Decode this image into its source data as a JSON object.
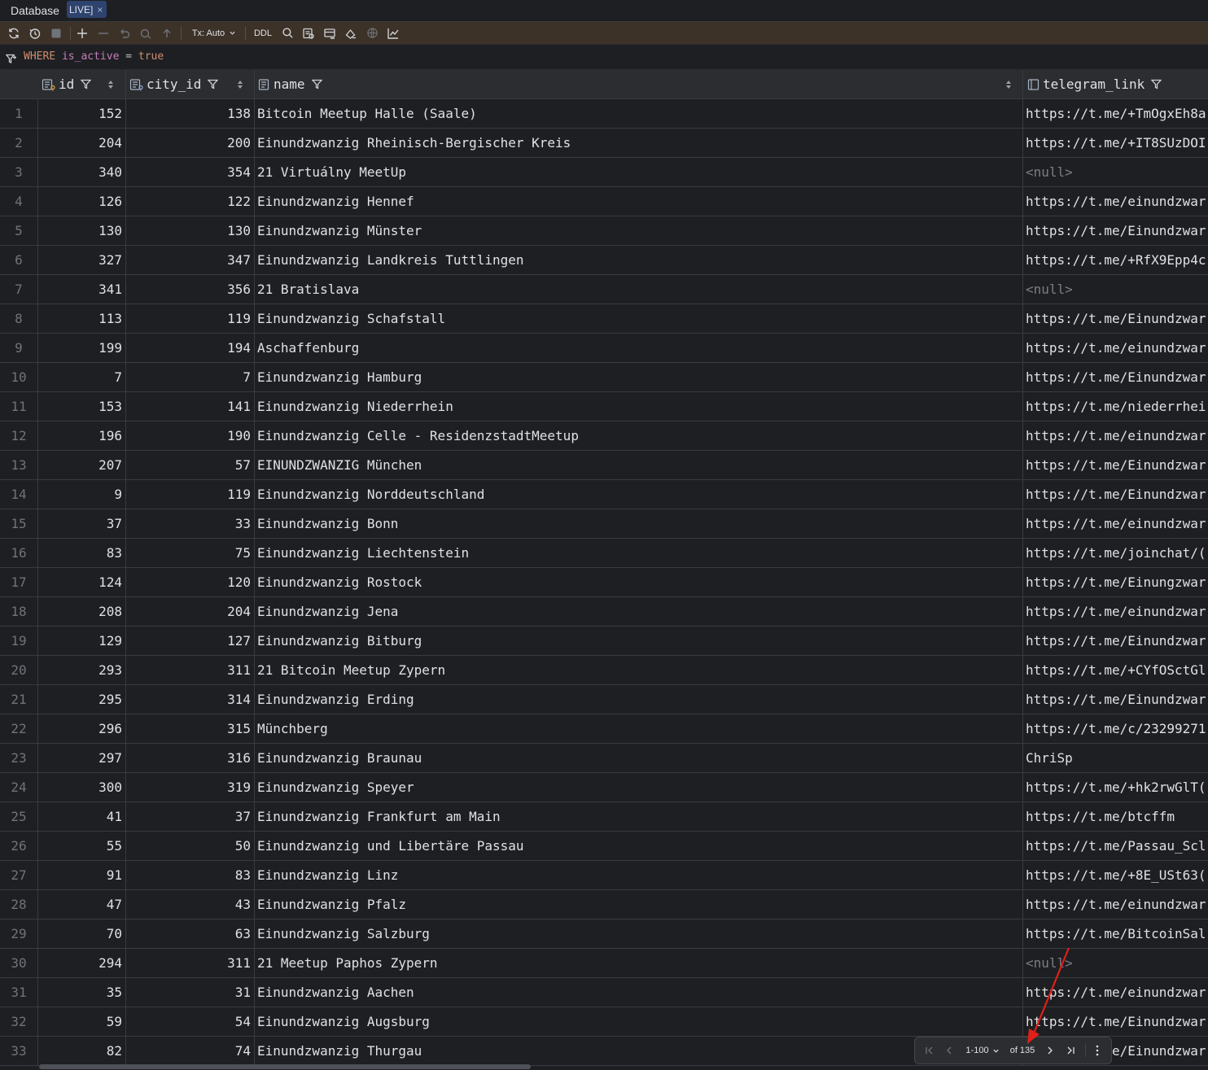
{
  "tabs": {
    "database_label": "Database",
    "active_tab_label": "LIVE]",
    "close_glyph": "×"
  },
  "toolbar": {
    "tx_label": "Tx: Auto",
    "ddl_label": "DDL"
  },
  "filter": {
    "keyword": "WHERE",
    "column": "is_active",
    "operator": "=",
    "value": "true"
  },
  "columns": {
    "id": "id",
    "city_id": "city_id",
    "name": "name",
    "telegram_link": "telegram_link"
  },
  "rows": [
    {
      "n": "1",
      "id": "152",
      "city_id": "138",
      "name": "Bitcoin Meetup Halle (Saale)",
      "telegram_link": "https://t.me/+TmOgxEh8a"
    },
    {
      "n": "2",
      "id": "204",
      "city_id": "200",
      "name": "Einundzwanzig Rheinisch-Bergischer Kreis",
      "telegram_link": "https://t.me/+IT8SUzDOI"
    },
    {
      "n": "3",
      "id": "340",
      "city_id": "354",
      "name": "21 Virtuálny MeetUp",
      "telegram_link": "<null>"
    },
    {
      "n": "4",
      "id": "126",
      "city_id": "122",
      "name": "Einundzwanzig Hennef",
      "telegram_link": "https://t.me/einundzwar"
    },
    {
      "n": "5",
      "id": "130",
      "city_id": "130",
      "name": "Einundzwanzig Münster",
      "telegram_link": "https://t.me/Einundzwar"
    },
    {
      "n": "6",
      "id": "327",
      "city_id": "347",
      "name": "Einundzwanzig Landkreis Tuttlingen",
      "telegram_link": "https://t.me/+RfX9Epp4c"
    },
    {
      "n": "7",
      "id": "341",
      "city_id": "356",
      "name": "21 Bratislava",
      "telegram_link": "<null>"
    },
    {
      "n": "8",
      "id": "113",
      "city_id": "119",
      "name": "Einundzwanzig Schafstall",
      "telegram_link": "https://t.me/Einundzwar"
    },
    {
      "n": "9",
      "id": "199",
      "city_id": "194",
      "name": "Aschaffenburg",
      "telegram_link": "https://t.me/einundzwar"
    },
    {
      "n": "10",
      "id": "7",
      "city_id": "7",
      "name": "Einundzwanzig Hamburg",
      "telegram_link": "https://t.me/Einundzwar"
    },
    {
      "n": "11",
      "id": "153",
      "city_id": "141",
      "name": "Einundzwanzig Niederrhein",
      "telegram_link": "https://t.me/niederrhei"
    },
    {
      "n": "12",
      "id": "196",
      "city_id": "190",
      "name": "Einundzwanzig Celle - ResidenzstadtMeetup",
      "telegram_link": "https://t.me/einundzwar"
    },
    {
      "n": "13",
      "id": "207",
      "city_id": "57",
      "name": "EINUNDZWANZIG München",
      "telegram_link": "https://t.me/Einundzwar"
    },
    {
      "n": "14",
      "id": "9",
      "city_id": "119",
      "name": "Einundzwanzig Norddeutschland",
      "telegram_link": "https://t.me/Einundzwar"
    },
    {
      "n": "15",
      "id": "37",
      "city_id": "33",
      "name": "Einundzwanzig Bonn",
      "telegram_link": "https://t.me/einundzwar"
    },
    {
      "n": "16",
      "id": "83",
      "city_id": "75",
      "name": "Einundzwanzig Liechtenstein",
      "telegram_link": "https://t.me/joinchat/("
    },
    {
      "n": "17",
      "id": "124",
      "city_id": "120",
      "name": "Einundzwanzig Rostock",
      "telegram_link": "https://t.me/Einungzwar"
    },
    {
      "n": "18",
      "id": "208",
      "city_id": "204",
      "name": "Einundzwanzig Jena",
      "telegram_link": "https://t.me/einundzwar"
    },
    {
      "n": "19",
      "id": "129",
      "city_id": "127",
      "name": "Einundzwanzig Bitburg",
      "telegram_link": "https://t.me/Einundzwar"
    },
    {
      "n": "20",
      "id": "293",
      "city_id": "311",
      "name": "21 Bitcoin Meetup Zypern",
      "telegram_link": "https://t.me/+CYfOSctGl"
    },
    {
      "n": "21",
      "id": "295",
      "city_id": "314",
      "name": "Einundzwanzig Erding",
      "telegram_link": "https://t.me/Einundzwar"
    },
    {
      "n": "22",
      "id": "296",
      "city_id": "315",
      "name": "Münchberg",
      "telegram_link": "https://t.me/c/23299271"
    },
    {
      "n": "23",
      "id": "297",
      "city_id": "316",
      "name": "Einundzwanzig Braunau",
      "telegram_link": "ChriSp"
    },
    {
      "n": "24",
      "id": "300",
      "city_id": "319",
      "name": "Einundzwanzig Speyer",
      "telegram_link": "https://t.me/+hk2rwGlT("
    },
    {
      "n": "25",
      "id": "41",
      "city_id": "37",
      "name": "Einundzwanzig Frankfurt am Main",
      "telegram_link": "https://t.me/btcffm"
    },
    {
      "n": "26",
      "id": "55",
      "city_id": "50",
      "name": "Einundzwanzig und Libertäre Passau",
      "telegram_link": "https://t.me/Passau_Scl"
    },
    {
      "n": "27",
      "id": "91",
      "city_id": "83",
      "name": "Einundzwanzig Linz",
      "telegram_link": "https://t.me/+8E_USt63("
    },
    {
      "n": "28",
      "id": "47",
      "city_id": "43",
      "name": "Einundzwanzig Pfalz",
      "telegram_link": "https://t.me/einundzwar"
    },
    {
      "n": "29",
      "id": "70",
      "city_id": "63",
      "name": "Einundzwanzig Salzburg",
      "telegram_link": "https://t.me/BitcoinSal"
    },
    {
      "n": "30",
      "id": "294",
      "city_id": "311",
      "name": "21 Meetup Paphos Zypern",
      "telegram_link": "<null>"
    },
    {
      "n": "31",
      "id": "35",
      "city_id": "31",
      "name": "Einundzwanzig Aachen",
      "telegram_link": "https://t.me/einundzwar"
    },
    {
      "n": "32",
      "id": "59",
      "city_id": "54",
      "name": "Einundzwanzig Augsburg",
      "telegram_link": "https://t.me/Einundzwar"
    },
    {
      "n": "33",
      "id": "82",
      "city_id": "74",
      "name": "Einundzwanzig Thurgau",
      "telegram_link": "https://t.me/Einundzwar"
    }
  ],
  "pagination": {
    "range_label": "1-100",
    "total_label": "of 135"
  },
  "icons": {
    "refresh": "refresh-icon",
    "history": "history-icon",
    "stop": "stop-icon",
    "add_row": "add-row-icon",
    "delete_row": "delete-row-icon",
    "revert": "revert-icon",
    "preview": "preview-icon",
    "submit": "submit-icon",
    "search": "search-icon",
    "compare": "compare-icon",
    "chart": "chart-icon"
  },
  "colors": {
    "background": "#1e1f22",
    "toolbar": "#3d3228",
    "header": "#2b2d30",
    "keyword": "#cf8e6d",
    "column_ref": "#c77dbb",
    "null_text": "#7a7e85",
    "annotation_arrow": "#e0201a"
  }
}
